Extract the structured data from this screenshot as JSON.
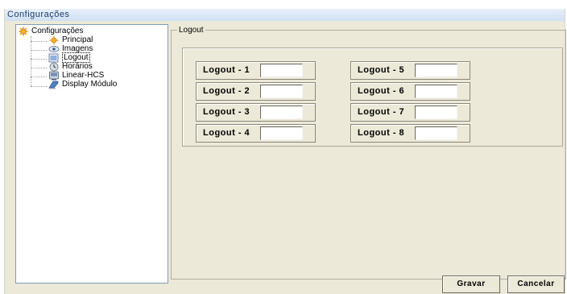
{
  "window": {
    "title": "Configurações"
  },
  "tree": {
    "root": {
      "label": "Configurações",
      "icon": "gear-icon"
    },
    "items": [
      {
        "label": "Principal",
        "icon": "gear-icon",
        "selected": false
      },
      {
        "label": "Imagens",
        "icon": "image-icon",
        "selected": false
      },
      {
        "label": "Logout",
        "icon": "logout-icon",
        "selected": true
      },
      {
        "label": "Horários",
        "icon": "clock-icon",
        "selected": false
      },
      {
        "label": "Linear-HCS",
        "icon": "device-icon",
        "selected": false
      },
      {
        "label": "Display Módulo",
        "icon": "display-icon",
        "selected": false
      }
    ]
  },
  "panel": {
    "group_title": "Logout",
    "fields": [
      {
        "label": "Logout - 1",
        "value": ""
      },
      {
        "label": "Logout - 2",
        "value": ""
      },
      {
        "label": "Logout - 3",
        "value": ""
      },
      {
        "label": "Logout - 4",
        "value": ""
      },
      {
        "label": "Logout - 5",
        "value": ""
      },
      {
        "label": "Logout - 6",
        "value": ""
      },
      {
        "label": "Logout - 7",
        "value": ""
      },
      {
        "label": "Logout - 8",
        "value": ""
      }
    ]
  },
  "buttons": {
    "save": "Gravar",
    "cancel": "Cancelar"
  },
  "colors": {
    "title_text": "#1b3d6b",
    "window_bg": "#ece9d8",
    "tree_border": "#7f9db9"
  }
}
